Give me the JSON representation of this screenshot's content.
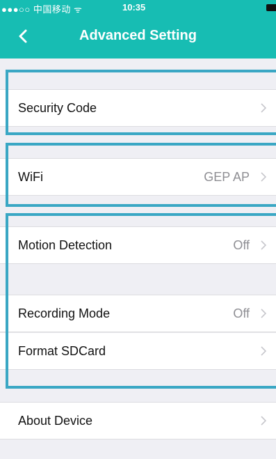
{
  "status_bar": {
    "carrier": "●●●○○ 中国移动 ᯤ",
    "time": "10:35"
  },
  "nav": {
    "title": "Advanced Setting",
    "back_icon": "chevron-left-icon"
  },
  "rows": {
    "security_code": {
      "label": "Security Code",
      "value": ""
    },
    "wifi": {
      "label": "WiFi",
      "value": "GEP AP"
    },
    "motion_detection": {
      "label": "Motion Detection",
      "value": "Off"
    },
    "recording_mode": {
      "label": "Recording Mode",
      "value": "Off"
    },
    "format_sdcard": {
      "label": "Format SDCard",
      "value": ""
    },
    "about_device": {
      "label": "About Device",
      "value": ""
    }
  },
  "colors": {
    "accent": "#17bdb3",
    "highlight": "#3aa7c4",
    "background": "#efeff4"
  }
}
